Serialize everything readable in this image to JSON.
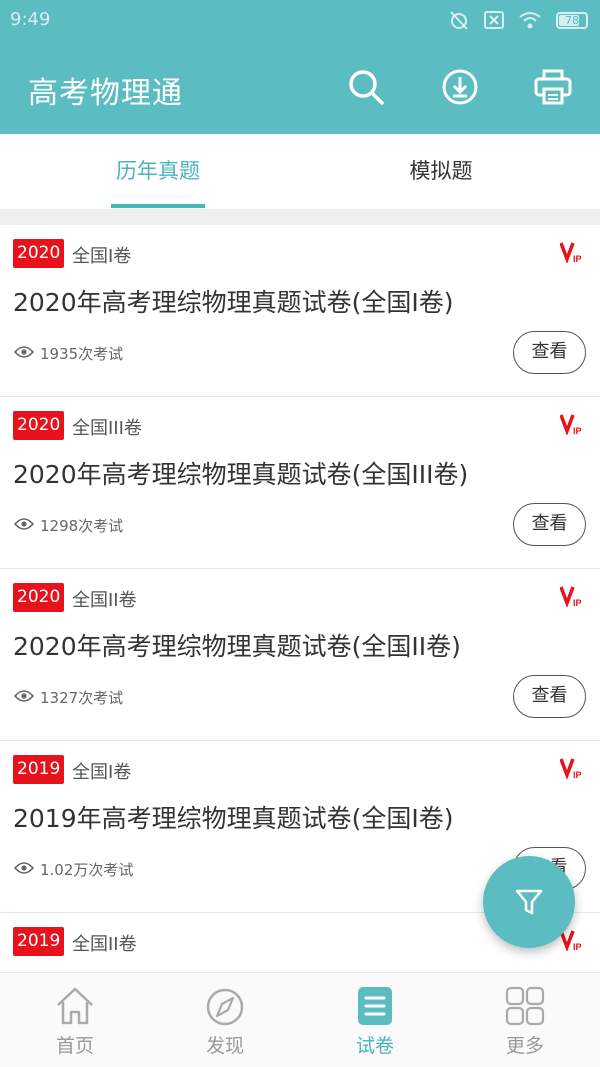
{
  "status_bar": {
    "time": "9:49",
    "battery": "78",
    "battery_level": 0.78
  },
  "app_bar": {
    "title": "高考物理通",
    "icons": [
      "search-icon",
      "download-icon",
      "printer-icon"
    ]
  },
  "tabs": [
    {
      "label": "历年真题",
      "active": true
    },
    {
      "label": "模拟题",
      "active": false
    }
  ],
  "papers": [
    {
      "year": "2020",
      "region": "全国I卷",
      "title": "2020年高考理综物理真题试卷(全国I卷)",
      "count": "1935次考试",
      "action": "查看"
    },
    {
      "year": "2020",
      "region": "全国III卷",
      "title": "2020年高考理综物理真题试卷(全国III卷)",
      "count": "1298次考试",
      "action": "查看"
    },
    {
      "year": "2020",
      "region": "全国II卷",
      "title": "2020年高考理综物理真题试卷(全国II卷)",
      "count": "1327次考试",
      "action": "查看"
    },
    {
      "year": "2019",
      "region": "全国I卷",
      "title": "2019年高考理综物理真题试卷(全国I卷)",
      "count": "1.02万次考试",
      "action": "查看"
    },
    {
      "year": "2019",
      "region": "全国II卷"
    }
  ],
  "bottom_nav": [
    {
      "label": "首页",
      "icon": "home-icon",
      "active": false
    },
    {
      "label": "发现",
      "icon": "compass-icon",
      "active": false
    },
    {
      "label": "试卷",
      "icon": "paper-icon",
      "active": true
    },
    {
      "label": "更多",
      "icon": "grid-icon",
      "active": false
    }
  ],
  "colors": {
    "primary": "#5bbdc2",
    "accent": "#4ab5bb",
    "badge": "#e8121c"
  }
}
